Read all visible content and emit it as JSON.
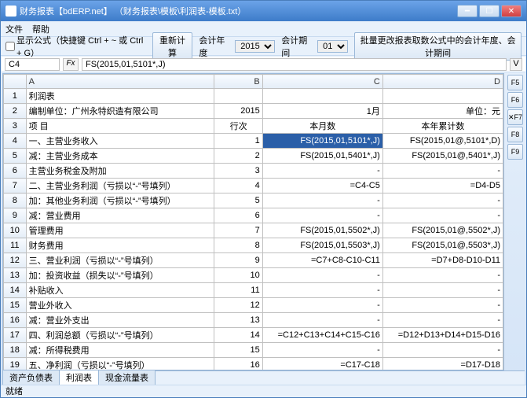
{
  "title": "财务报表【bdERP.net】 （财务报表\\模板\\利润表-模板.txt）",
  "menu": {
    "file": "文件",
    "help": "帮助"
  },
  "toolbar": {
    "show_formula": "显示公式（快捷键 Ctrl + ~ 或 Ctrl + G）",
    "recalc": "重新计算",
    "fy_label": "会计年度",
    "fy_value": "2015",
    "fp_label": "会计期间",
    "fp_value": "01",
    "batch": "批量更改报表取数公式中的会计年度、会计期间"
  },
  "formula": {
    "cell": "C4",
    "fx": "Fx",
    "text": "FS(2015,01,5101*,J)",
    "v": "V"
  },
  "cols": [
    "",
    "A",
    "B",
    "C",
    "D"
  ],
  "rows": [
    {
      "n": "1",
      "a": "利润表",
      "b": "",
      "c": "",
      "d": ""
    },
    {
      "n": "2",
      "a": "编制单位：广州永特织造有限公司",
      "b": "2015",
      "c": "1月",
      "d": "单位：元"
    },
    {
      "n": "3",
      "a": "项                                目",
      "b": "行次",
      "c": "本月数",
      "d": "本年累计数"
    },
    {
      "n": "4",
      "a": "一、主营业务收入",
      "b": "1",
      "c": "FS(2015,01,5101*,J)",
      "d": "FS(2015,01@,5101*,D)",
      "sel": true
    },
    {
      "n": "5",
      "a": "减：主营业务成本",
      "b": "2",
      "c": "FS(2015,01,5401*,J)",
      "d": "FS(2015,01@,5401*,J)"
    },
    {
      "n": "6",
      "a": "    主营业务税金及附加",
      "b": "3",
      "c": "-",
      "d": "-"
    },
    {
      "n": "7",
      "a": "二、主营业务利润（亏损以“-”号填列）",
      "b": "4",
      "c": "=C4-C5",
      "d": "=D4-D5"
    },
    {
      "n": "8",
      "a": "加：其他业务利润（亏损以“-”号填列）",
      "b": "5",
      "c": "-",
      "d": "-"
    },
    {
      "n": "9",
      "a": "减：营业费用",
      "b": "6",
      "c": "-",
      "d": "-"
    },
    {
      "n": "10",
      "a": "    管理费用",
      "b": "7",
      "c": "FS(2015,01,5502*,J)",
      "d": "FS(2015,01@,5502*,J)"
    },
    {
      "n": "11",
      "a": "    财务费用",
      "b": "8",
      "c": "FS(2015,01,5503*,J)",
      "d": "FS(2015,01@,5503*,J)"
    },
    {
      "n": "12",
      "a": "三、营业利润（亏损以“-”号填列）",
      "b": "9",
      "c": "=C7+C8-C10-C11",
      "d": "=D7+D8-D10-D11"
    },
    {
      "n": "13",
      "a": "加：投资收益（损失以“-”号填列）",
      "b": "10",
      "c": "-",
      "d": "-"
    },
    {
      "n": "14",
      "a": "    补贴收入",
      "b": "11",
      "c": "-",
      "d": "-"
    },
    {
      "n": "15",
      "a": "    营业外收入",
      "b": "12",
      "c": "-",
      "d": "-"
    },
    {
      "n": "16",
      "a": "减：营业外支出",
      "b": "13",
      "c": "-",
      "d": "-"
    },
    {
      "n": "17",
      "a": "四、利润总额（亏损以“-”号填列）",
      "b": "14",
      "c": "=C12+C13+C14+C15-C16",
      "d": "=D12+D13+D14+D15-D16"
    },
    {
      "n": "18",
      "a": "减：所得税费用",
      "b": "15",
      "c": "-",
      "d": "-"
    },
    {
      "n": "19",
      "a": "五、净利润（亏损以“-”号填列）",
      "b": "16",
      "c": "=C17-C18",
      "d": "=D17-D18"
    }
  ],
  "sidebtns": [
    "F5",
    "F6",
    "✕F7",
    "F8",
    "F9"
  ],
  "tabs": [
    {
      "label": "资产负债表"
    },
    {
      "label": "利润表",
      "active": true
    },
    {
      "label": "现金流量表"
    }
  ],
  "status": "就绪"
}
